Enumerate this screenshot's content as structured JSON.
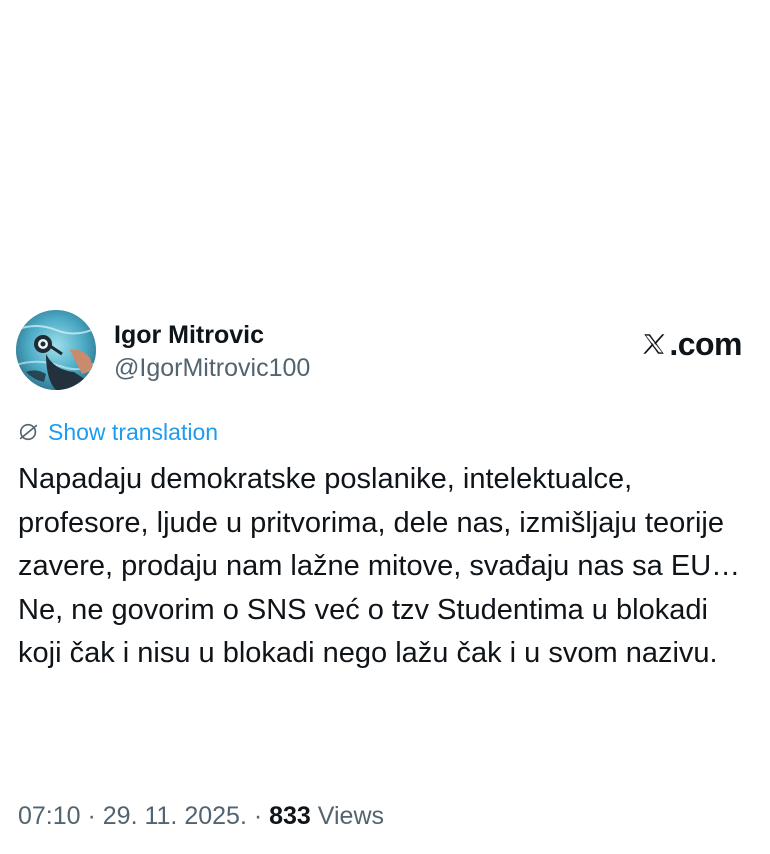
{
  "author": {
    "display_name": "Igor Mitrovic",
    "handle": "@IgorMitrovic100",
    "avatar_icon": "profile-photo"
  },
  "brand": {
    "logo_icon": "x-logo-icon",
    "text": ".com"
  },
  "translation": {
    "label": "Show translation",
    "icon": "globe-icon"
  },
  "tweet": {
    "text": "Napadaju demokratske poslanike, intelektualce, profesore, ljude u pritvorima, dele nas, izmišljaju teorije zavere, prodaju nam lažne mitove, svađaju nas sa EU…\nNe, ne govorim o SNS već o tzv Studentima u blokadi koji čak i nisu u blokadi nego lažu čak i u svom nazivu."
  },
  "meta": {
    "time": "07:10",
    "separator": " · ",
    "date": "29. 11. 2025.",
    "separator2": " · ",
    "views_count": "833",
    "views_label": " Views"
  },
  "colors": {
    "text_primary": "#0f1419",
    "text_secondary": "#536471",
    "link_blue": "#1d9bf0",
    "background": "#ffffff"
  }
}
